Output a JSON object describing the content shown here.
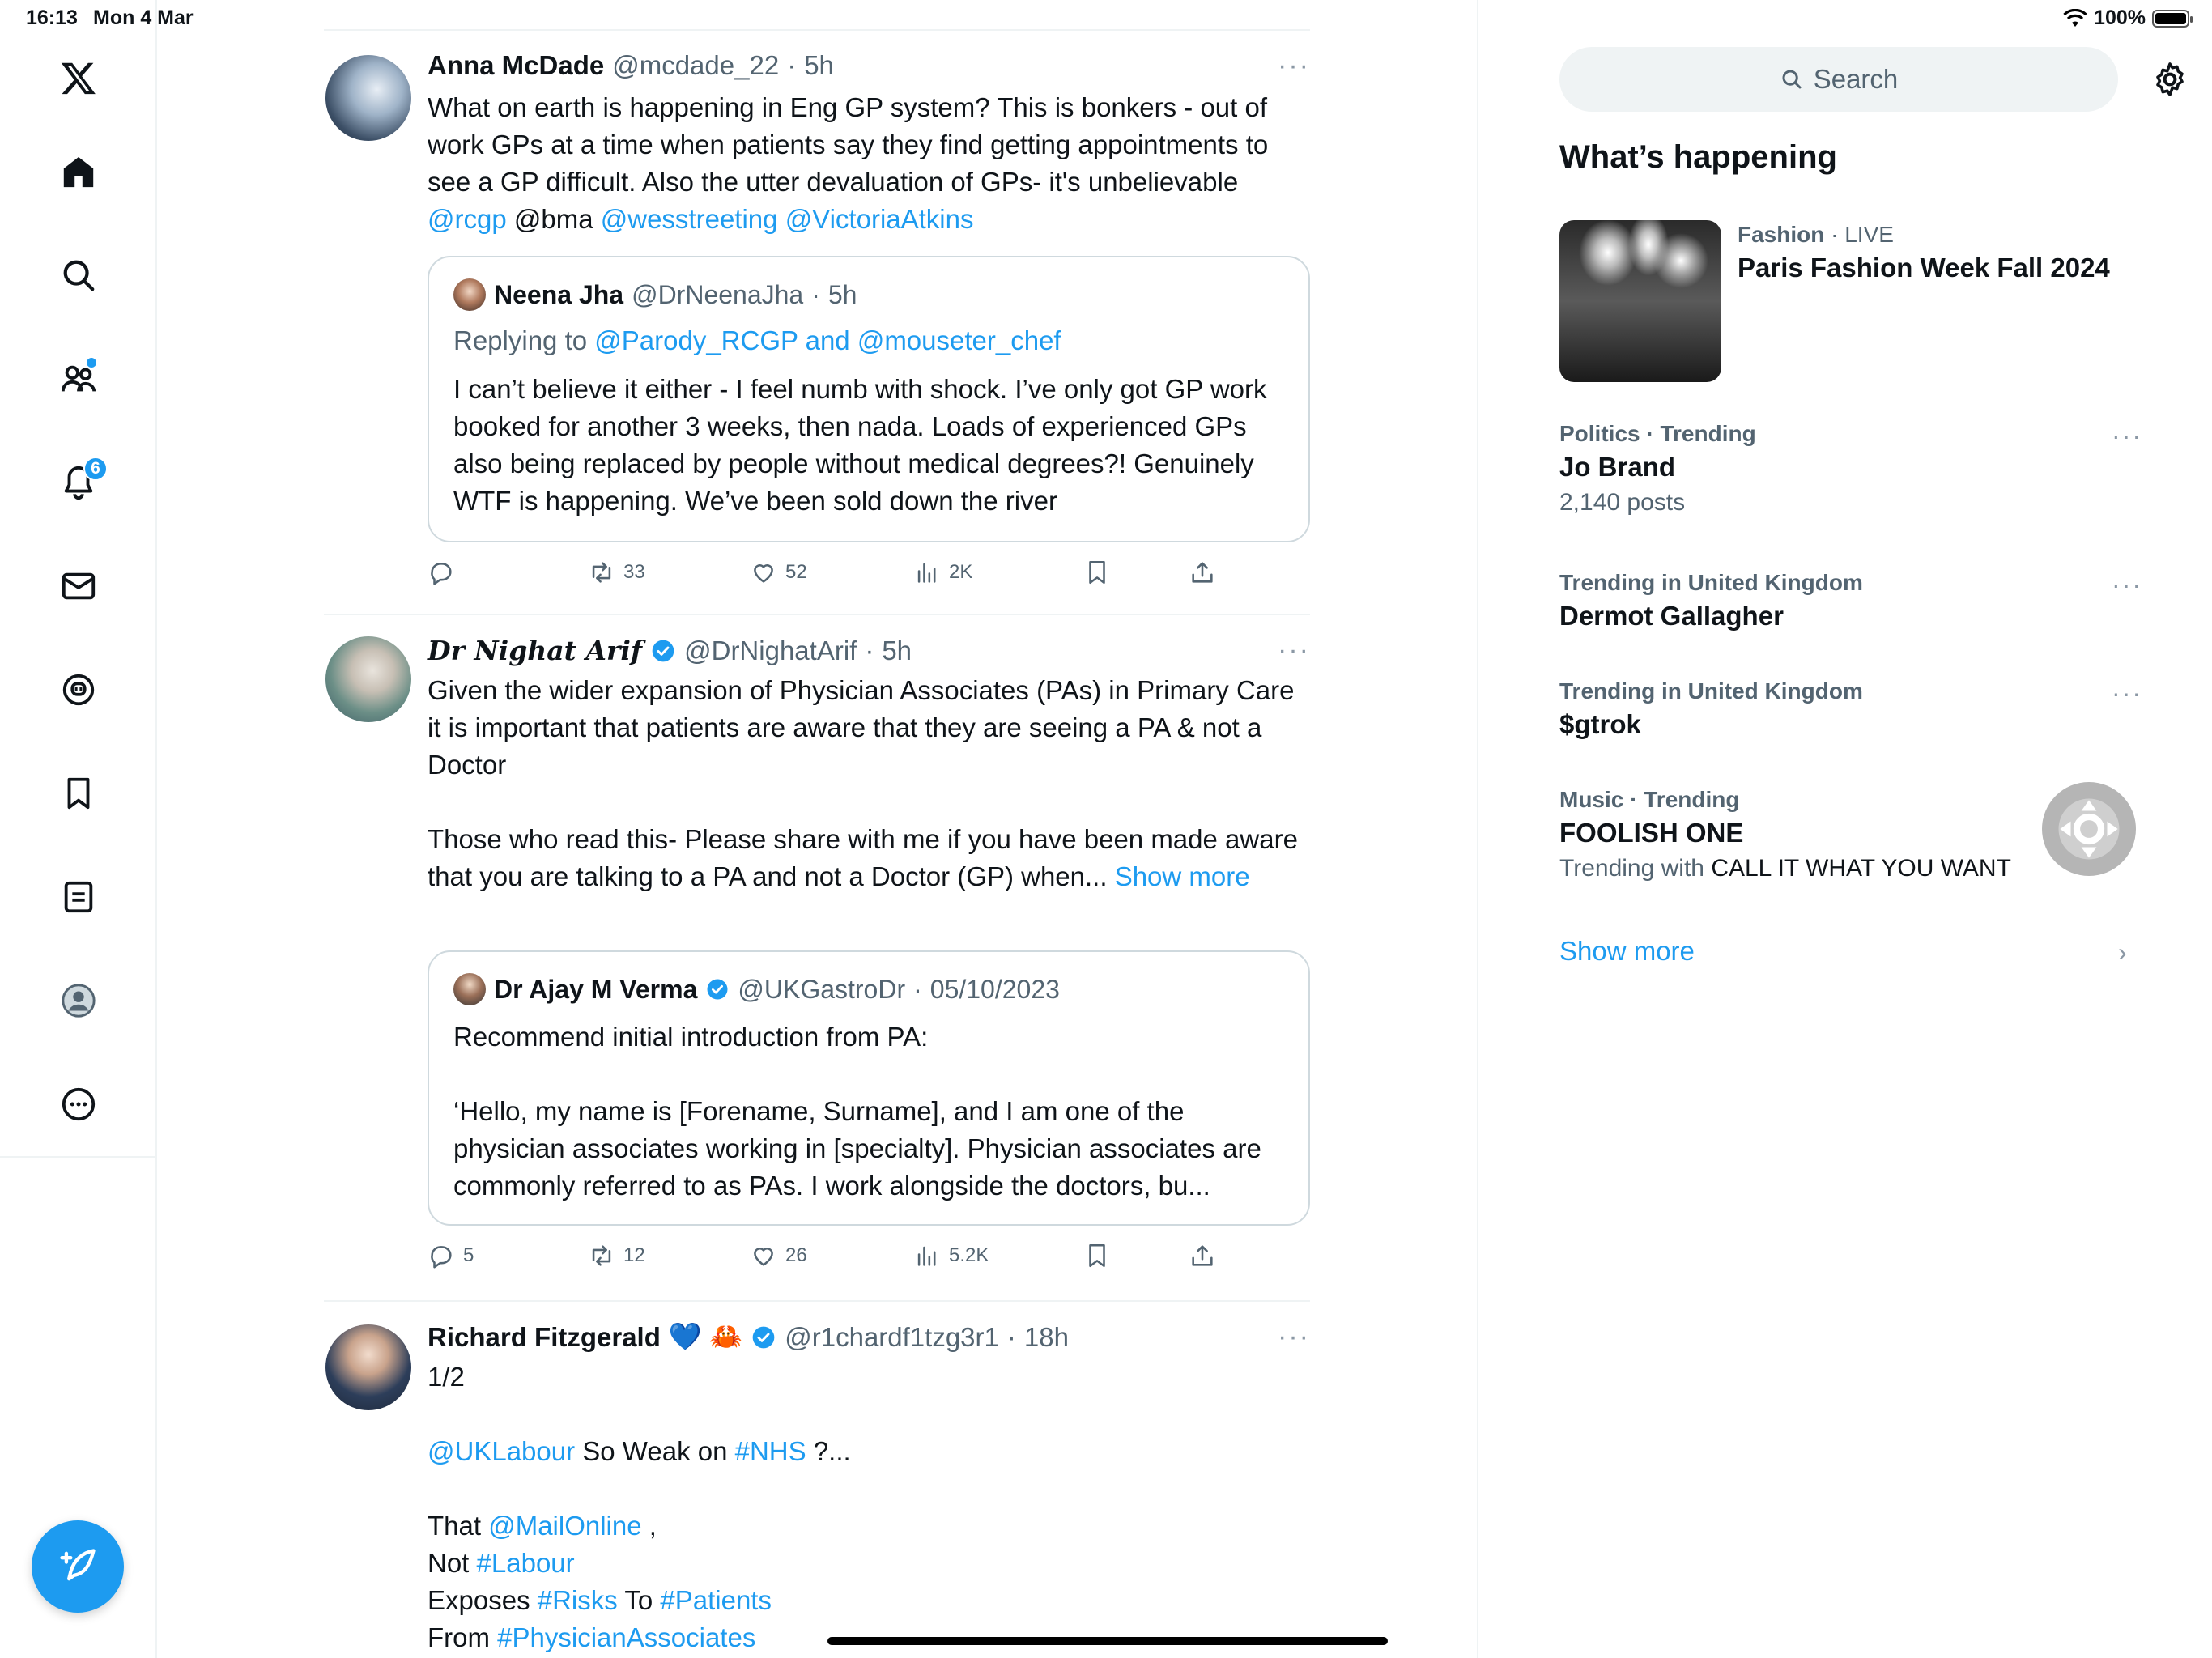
{
  "status_bar": {
    "time": "16:13",
    "date": "Mon 4 Mar",
    "battery": "100%"
  },
  "nav": {
    "notifications_count": "6"
  },
  "tweets": [
    {
      "name": "Anna McDade",
      "handle": "@mcdade_22",
      "time": "5h",
      "text_1": "What on earth is happening in Eng GP system? This is bonkers - out of work GPs at a time when patients say they find getting appointments to see a GP difficult. Also the utter devaluation of GPs- it's unbelievable ",
      "mention_1": "@rcgp",
      "text_2": " @bma ",
      "mention_2": "@wesstreeting",
      "mention_3": "@VictoriaAtkins",
      "quote": {
        "name": "Neena Jha",
        "handle": "@DrNeenaJha",
        "time": "5h",
        "replying_to_label": "Replying to ",
        "replying_to": "@Parody_RCGP and @mouseter_chef",
        "text": "I can’t believe it either - I feel numb with shock. I’ve only got GP work booked for another 3 weeks, then nada. Loads of experienced GPs also being replaced by people without medical degrees?! Genuinely WTF is happening. We’ve been sold down the river"
      },
      "replies": "",
      "reposts": "33",
      "likes": "52",
      "views": "2K"
    },
    {
      "name": "Dr Nighat Arif",
      "handle": "@DrNighatArif",
      "time": "5h",
      "text_1": "Given the wider expansion of Physician Associates (PAs) in Primary Care it is important that patients are aware that they are seeing a PA & not a Doctor",
      "text_2": "Those who read this- Please share with me if you have been made aware that you are talking to a PA and not a Doctor (GP) when... ",
      "show_more": "Show more",
      "quote": {
        "name": "Dr Ajay M Verma",
        "handle": "@UKGastroDr",
        "time": "05/10/2023",
        "text_1": "Recommend initial introduction from PA:",
        "text_2": "‘Hello, my name is [Forename, Surname], and I am one of the physician associates working in [specialty]. Physician associates are commonly referred to as PAs. I work alongside the doctors, bu..."
      },
      "replies": "5",
      "reposts": "12",
      "likes": "26",
      "views": "5.2K"
    },
    {
      "name": "Richard Fitzgerald",
      "emoji": "💙 🦀",
      "handle": "@r1chardf1tzg3r1",
      "time": "18h",
      "line_1": "1/2",
      "mention_1": "@UKLabour",
      "text_1": " So Weak on ",
      "tag_1": "#NHS",
      "text_2": " ?...",
      "text_3": "That ",
      "mention_2": "@MailOnline",
      "text_4": " ,",
      "text_5": "Not ",
      "tag_2": "#Labour",
      "text_6": "Exposes ",
      "tag_3": "#Risks",
      "text_7": " To ",
      "tag_4": "#Patients",
      "text_8": "From ",
      "tag_5": "#PhysicianAssociates"
    }
  ],
  "right": {
    "search_placeholder": "Search",
    "title": "What’s happening",
    "trends": [
      {
        "category": "Fashion",
        "live": "LIVE",
        "title": "Paris Fashion Week Fall 2024"
      },
      {
        "category": "Politics · Trending",
        "title": "Jo Brand",
        "sub": "2,140 posts"
      },
      {
        "category": "Trending in United Kingdom",
        "title": "Dermot Gallagher"
      },
      {
        "category": "Trending in United Kingdom",
        "title": "$gtrok"
      },
      {
        "category": "Music · Trending",
        "title": "FOOLISH ONE",
        "sub_prefix": "Trending with ",
        "sub_value": "CALL IT WHAT YOU WANT"
      }
    ],
    "show_more": "Show more"
  },
  "colors": {
    "accent": "#1d9bf0",
    "text": "#0f1419",
    "muted": "#536471",
    "border": "#eff3f4"
  }
}
